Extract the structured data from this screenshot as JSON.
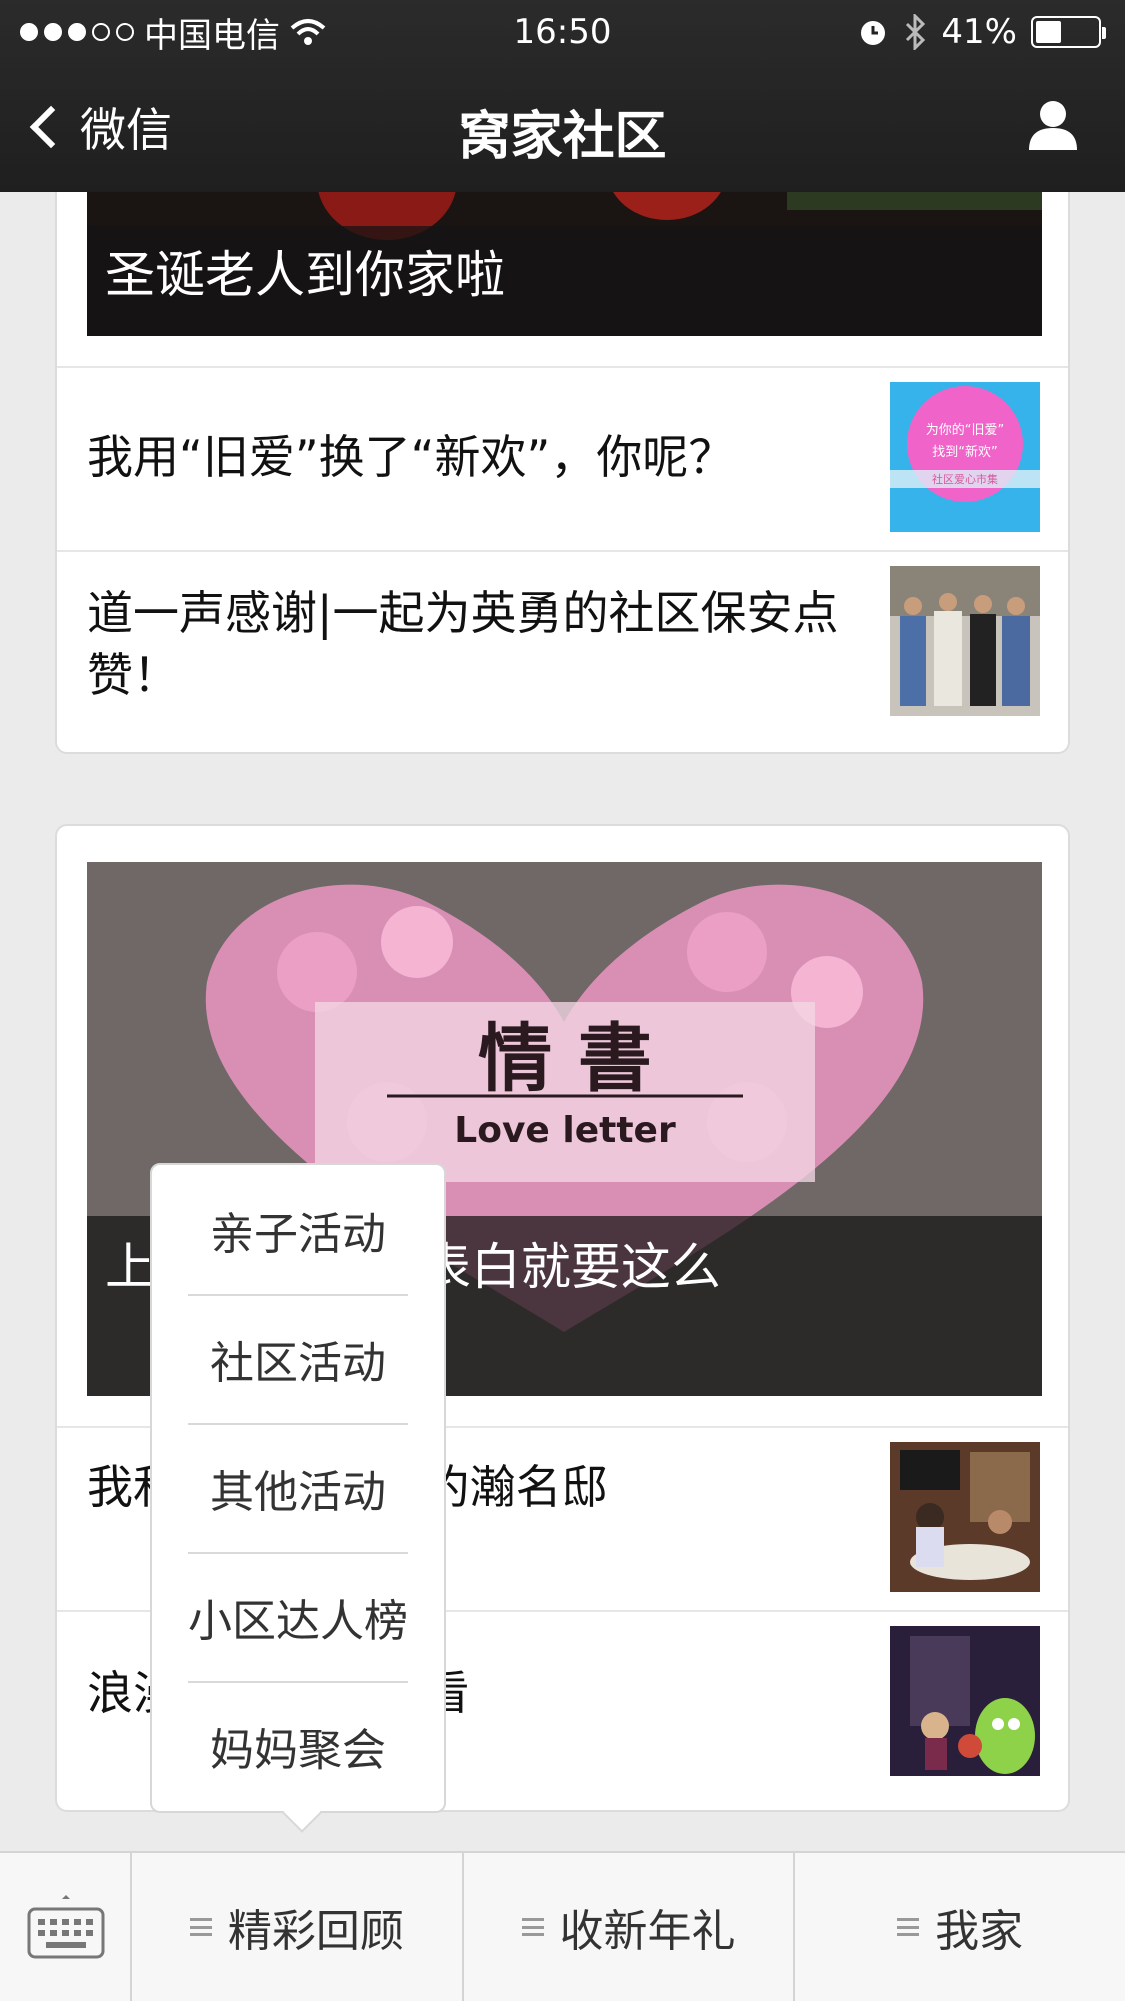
{
  "status_bar": {
    "carrier": "中国电信",
    "time": "16:50",
    "battery_percent": "41%",
    "battery_level": 0.41
  },
  "nav": {
    "back_label": "微信",
    "title": "窝家社区"
  },
  "feed": {
    "card1": {
      "hero_caption": "圣诞老人到你家啦",
      "rows": [
        {
          "title": "我用“旧爱”换了“新欢”，你呢？",
          "thumb_text_1": "为你的“旧爱”",
          "thumb_text_2": "找到“新欢”",
          "thumb_text_3": "社区爱心市集"
        },
        {
          "title": "道一声感谢|一起为英勇的社区保安点赞！"
        }
      ]
    },
    "card2": {
      "hero_heading": "情    書",
      "hero_sub": "Love  letter",
      "hero_caption": "上                    贴满情书，表白就要这么",
      "rows": [
        {
          "title": "我和                    会——记圣约瀚名邸"
        },
        {
          "title": "浪漫                    映电影免费看"
        }
      ]
    }
  },
  "popup_menu": {
    "items": [
      "亲子活动",
      "社区活动",
      "其他活动",
      "小区达人榜",
      "妈妈聚会"
    ]
  },
  "bottom_menu": {
    "items": [
      "精彩回顾",
      "收新年礼",
      "我家"
    ]
  },
  "colors": {
    "nav_bg": "#222222",
    "page_bg": "#ebebeb",
    "caption_bg": "#141414"
  }
}
